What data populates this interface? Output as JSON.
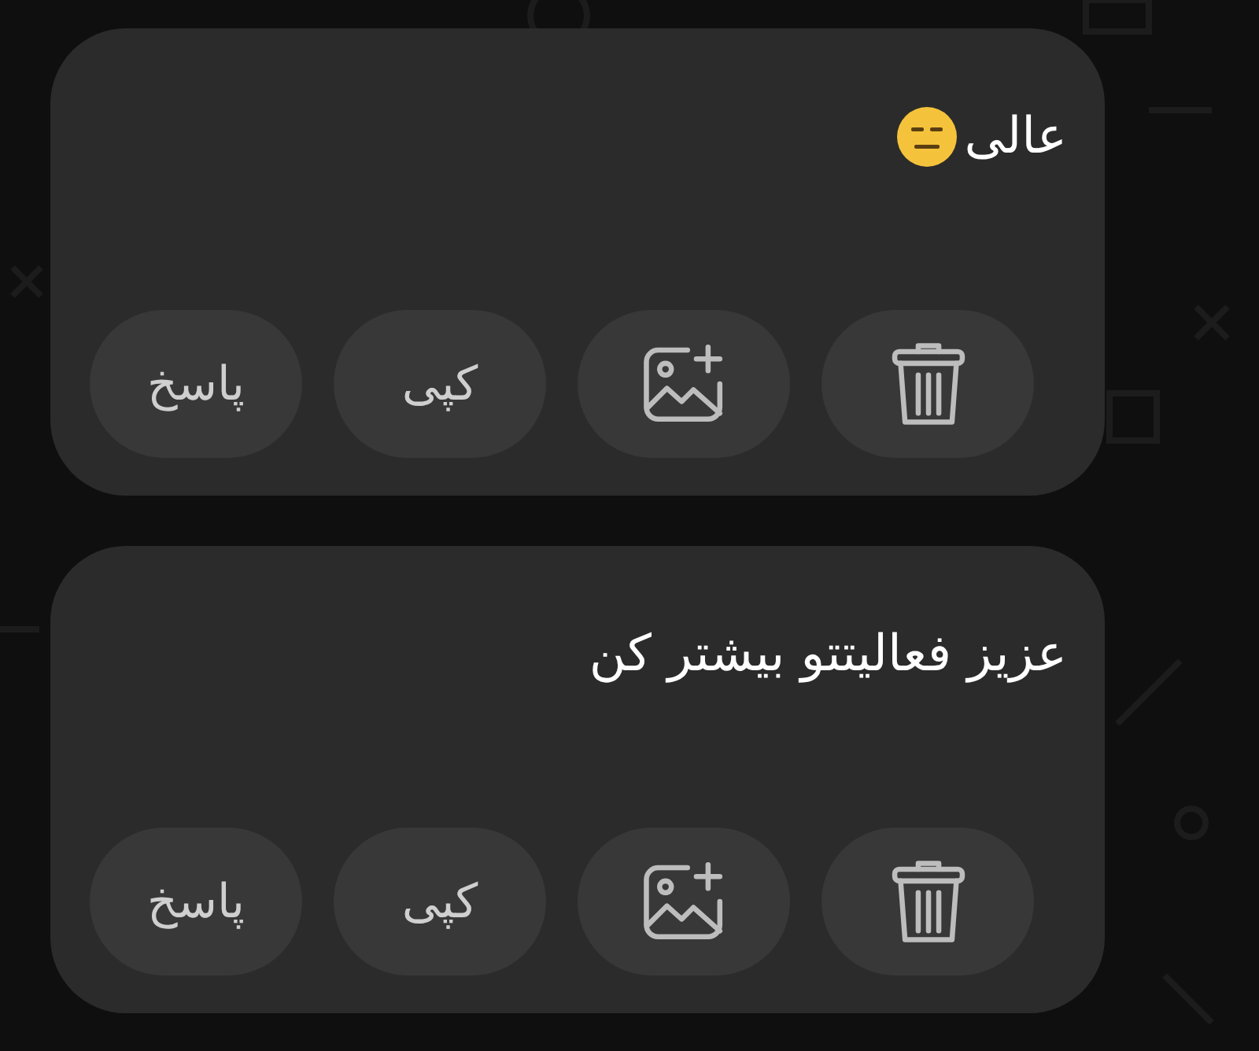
{
  "messages": [
    {
      "text": "عالی",
      "emoji": true,
      "actions": [
        {
          "kind": "delete"
        },
        {
          "kind": "add-image"
        },
        {
          "kind": "text",
          "label": "کپی"
        },
        {
          "kind": "text",
          "label": "پاسخ"
        }
      ]
    },
    {
      "text": "عزیز فعالیتتو بیشتر کن",
      "actions": [
        {
          "kind": "delete"
        },
        {
          "kind": "add-image"
        },
        {
          "kind": "text",
          "label": "کپی"
        },
        {
          "kind": "text",
          "label": "پاسخ"
        }
      ]
    }
  ]
}
